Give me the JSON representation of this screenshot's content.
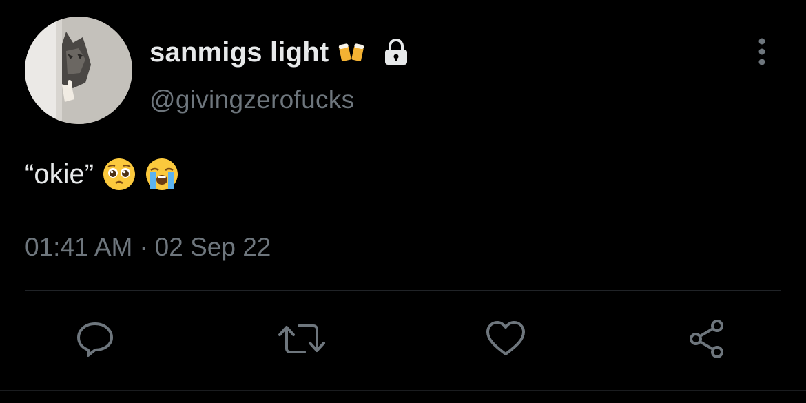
{
  "tweet": {
    "author": {
      "display_name": "sanmigs light",
      "name_emoji": "beer-mugs-emoji",
      "protected_icon": "lock-icon",
      "handle": "@givingzerofucks"
    },
    "text": "“okie”",
    "emojis": [
      "pleading-face-emoji",
      "loudly-crying-face-emoji"
    ],
    "time": "01:41 AM",
    "separator": "·",
    "date": "02 Sep 22",
    "actions": [
      "reply-icon",
      "retweet-icon",
      "like-icon",
      "share-icon"
    ],
    "more_icon": "more-vertical-icon"
  },
  "colors": {
    "background": "#000000",
    "primary_text": "#e7e9ea",
    "secondary_text": "#6e767d",
    "divider": "#202327"
  }
}
